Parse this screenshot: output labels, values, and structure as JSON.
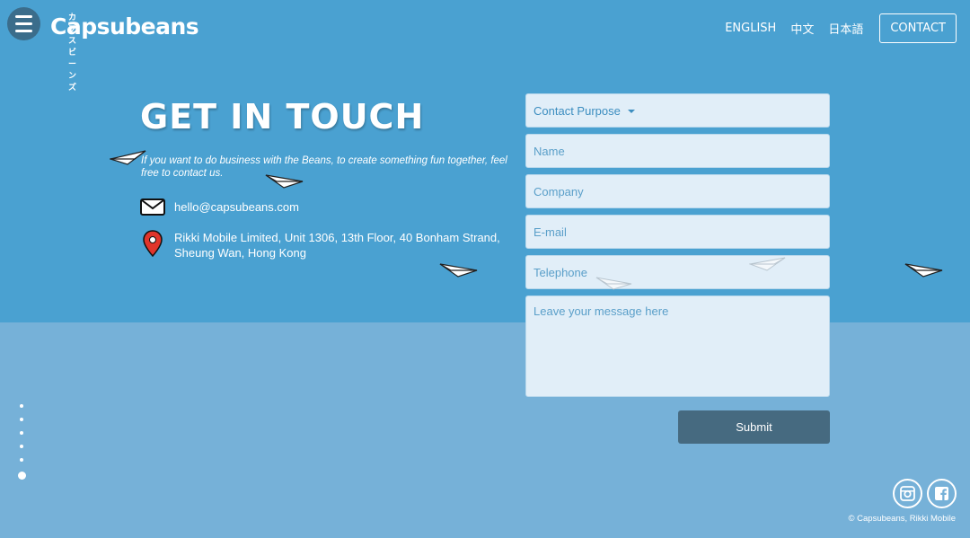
{
  "header": {
    "menu_icon": "hamburger-icon",
    "logo_kana": "カプスビーンズ",
    "logo_text": "Capsubeans",
    "nav": {
      "english": "ENGLISH",
      "chinese": "中文",
      "japanese": "日本語",
      "contact": "CONTACT"
    }
  },
  "main": {
    "title": "GET IN TOUCH",
    "intro": "If you want to do business with the Beans, to create something fun together, feel free to contact us.",
    "email": "hello@capsubeans.com",
    "address_line1": "Rikki Mobile Limited, Unit 1306, 13th Floor, 40 Bonham Strand,",
    "address_line2": "Sheung Wan, Hong Kong"
  },
  "form": {
    "purpose": "Contact Purpose",
    "name_placeholder": "Name",
    "company_placeholder": "Company",
    "email_placeholder": "E-mail",
    "telephone_placeholder": "Telephone",
    "message_placeholder": "Leave your message here",
    "submit": "Submit"
  },
  "footer": {
    "copyright": "© Capsubeans, Rikki Mobile"
  },
  "colors": {
    "top_band": "#4aa1d1",
    "bottom_band": "#76b1d8",
    "submit": "#466a80"
  }
}
